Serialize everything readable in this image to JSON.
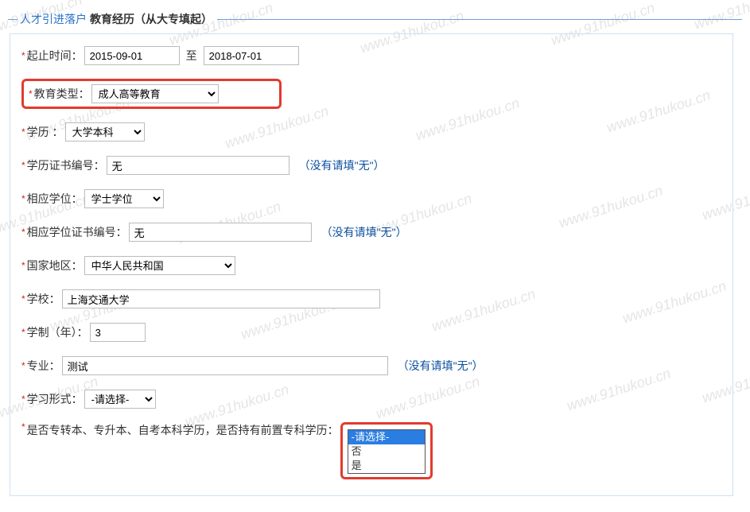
{
  "watermark_text": "www.91hukou.cn",
  "legend": {
    "title1": "人才引进落户",
    "title2": "教育经历（从大专填起）"
  },
  "labels": {
    "date_range": "起止时间：",
    "to": "至",
    "edu_type": "教育类型：",
    "degree": "学历 ：",
    "cert_no": "学历证书编号：",
    "corr_degree": "相应学位：",
    "corr_degree_cert": "相应学位证书编号：",
    "country": "国家地区：",
    "school": "学校：",
    "duration": "学制（年）：",
    "major": "专业：",
    "study_form": "学习形式：",
    "prior_junior": "是否专转本、专升本、自考本科学历，是否持有前置专科学历："
  },
  "values": {
    "date_from": "2015-09-01",
    "date_to": "2018-07-01",
    "edu_type": "成人高等教育",
    "degree": "大学本科",
    "cert_no": "无",
    "corr_degree": "学士学位",
    "corr_degree_cert": "无",
    "country": "中华人民共和国",
    "school": "上海交通大学",
    "duration": "3",
    "major": "测试",
    "study_form": "-请选择-"
  },
  "hints": {
    "none_fill": "（没有请填\"无\"）"
  },
  "dropdown": {
    "opt_placeholder": "-请选择-",
    "opt_no": "否",
    "opt_yes": "是"
  }
}
